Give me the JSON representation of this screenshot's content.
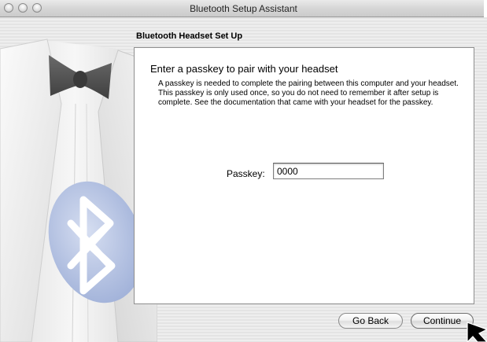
{
  "window": {
    "title": "Bluetooth Setup Assistant"
  },
  "section": {
    "heading": "Bluetooth Headset Set Up"
  },
  "content": {
    "prompt": "Enter a passkey to pair with your headset",
    "description": "A passkey is needed to complete the pairing between this computer and your headset. This passkey is only used once, so you do not need to remember it after setup is complete. See the documentation that came with your headset for the passkey.",
    "passkey_label": "Passkey:",
    "passkey_value": "0000"
  },
  "buttons": {
    "back_label": "Go Back",
    "continue_label": "Continue"
  },
  "colors": {
    "bluetooth_blue": "#b9c6e4",
    "window_background": "#ececec",
    "panel_background": "#ffffff"
  },
  "icons": {
    "illustration": "bluetooth-headset-illustration",
    "cursor": "arrow-cursor"
  }
}
